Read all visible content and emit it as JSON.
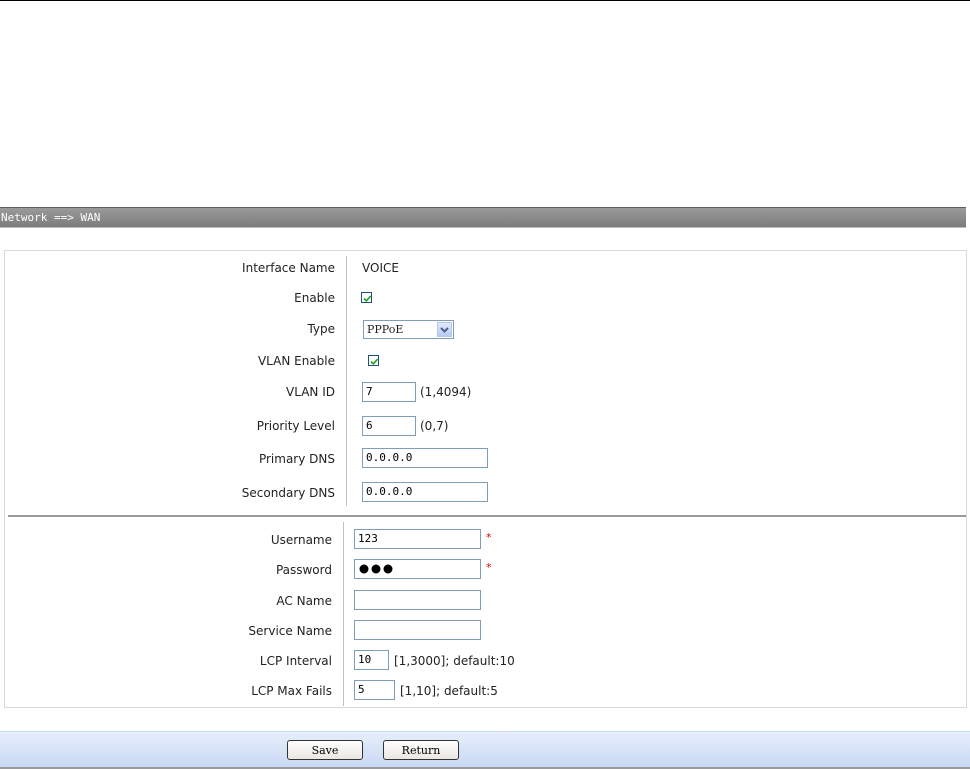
{
  "header": {
    "title": "Network ==> WAN"
  },
  "wan": {
    "interface_name": {
      "label": "Interface Name",
      "value": "VOICE"
    },
    "enable": {
      "label": "Enable",
      "checked": true
    },
    "type": {
      "label": "Type",
      "value": "PPPoE"
    },
    "vlan_enable": {
      "label": "VLAN Enable",
      "checked": true
    },
    "vlan_id": {
      "label": "VLAN ID",
      "value": "7",
      "hint": "(1,4094)"
    },
    "priority_level": {
      "label": "Priority Level",
      "value": "6",
      "hint": "(0,7)"
    },
    "primary_dns": {
      "label": "Primary DNS",
      "value": "0.0.0.0"
    },
    "secondary_dns": {
      "label": "Secondary DNS",
      "value": "0.0.0.0"
    }
  },
  "pppoe": {
    "username": {
      "label": "Username",
      "value": "123",
      "required_mark": "*"
    },
    "password": {
      "label": "Password",
      "masked_length": 3,
      "required_mark": "*"
    },
    "ac_name": {
      "label": "AC Name",
      "value": ""
    },
    "service_name": {
      "label": "Service Name",
      "value": ""
    },
    "lcp_interval": {
      "label": "LCP Interval",
      "value": "10",
      "hint": "[1,3000]; default:10"
    },
    "lcp_max_fails": {
      "label": "LCP Max Fails",
      "value": "5",
      "hint": "[1,10]; default:5"
    }
  },
  "buttons": {
    "save": "Save",
    "return": "Return"
  },
  "colors": {
    "header_bg": "#8a8a8a",
    "required": "#e00000",
    "footer_bg": "#d6e3f7",
    "input_border": "#7f9db9"
  },
  "icons": {
    "checkbox": "checkmark-icon",
    "select": "chevron-down-icon"
  }
}
